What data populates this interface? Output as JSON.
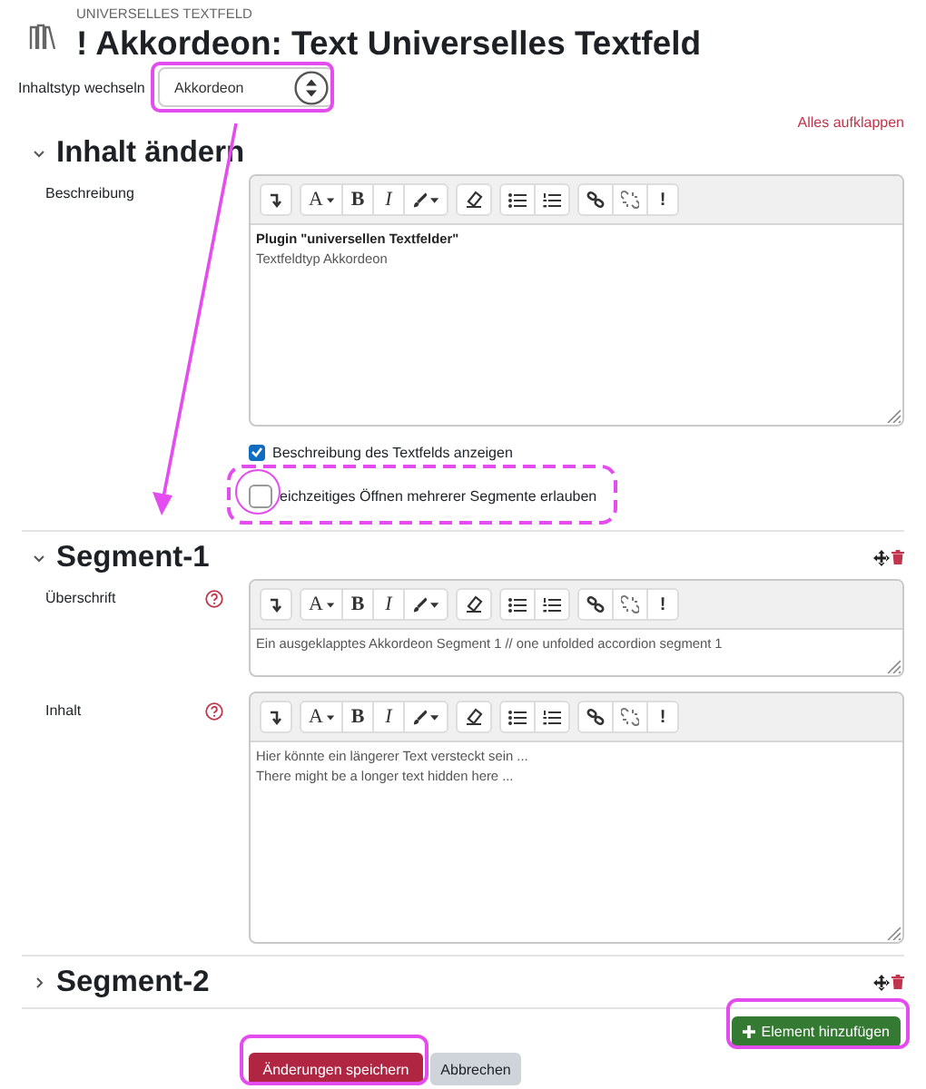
{
  "header": {
    "overline": "UNIVERSELLES TEXTFELD",
    "title": "! Akkordeon: Text Universelles Textfeld"
  },
  "type_switch": {
    "label": "Inhaltstyp wechseln",
    "value": "Akkordeon"
  },
  "expand_all": "Alles aufklappen",
  "sections": [
    {
      "title": "Inhalt ändern",
      "expanded": true,
      "actions": false,
      "fields": [
        {
          "kind": "editor",
          "label": "Beschreibung",
          "help": false,
          "toolbar": [
            "A",
            "B",
            "I",
            "!"
          ],
          "content": [
            {
              "text": "Plugin \"universellen Textfelder\"",
              "bold": true
            },
            {
              "text": "Textfeldtyp Akkordeon",
              "bold": false
            }
          ]
        },
        {
          "kind": "checkbox",
          "label": "Beschreibung des Textfelds anzeigen",
          "checked": true
        },
        {
          "kind": "checkbox",
          "label": "eichzeitiges Öffnen mehrerer Segmente erlauben",
          "checked": false
        }
      ]
    },
    {
      "title": "Segment-1",
      "expanded": true,
      "actions": true,
      "fields": [
        {
          "kind": "line-editor",
          "label": "Überschrift",
          "help": true,
          "toolbar": [
            "A",
            "B",
            "I",
            "!"
          ],
          "content": [
            {
              "text": "Ein ausgeklapptes Akkordeon Segment 1 // one unfolded accordion segment 1",
              "bold": false
            }
          ]
        },
        {
          "kind": "editor",
          "label": "Inhalt",
          "help": true,
          "toolbar": [
            "A",
            "B",
            "I",
            "!"
          ],
          "content": [
            {
              "text": "Hier könnte ein längerer Text versteckt sein ...",
              "bold": false
            },
            {
              "text": "There might be a longer text hidden here ...",
              "bold": false
            }
          ]
        }
      ]
    },
    {
      "title": "Segment-2",
      "expanded": false,
      "actions": true
    }
  ],
  "add_button": "Element hinzufügen",
  "buttons": [
    {
      "label": "Änderungen speichern",
      "kind": "primary"
    },
    {
      "label": "Abbrechen",
      "kind": "secondary"
    }
  ]
}
